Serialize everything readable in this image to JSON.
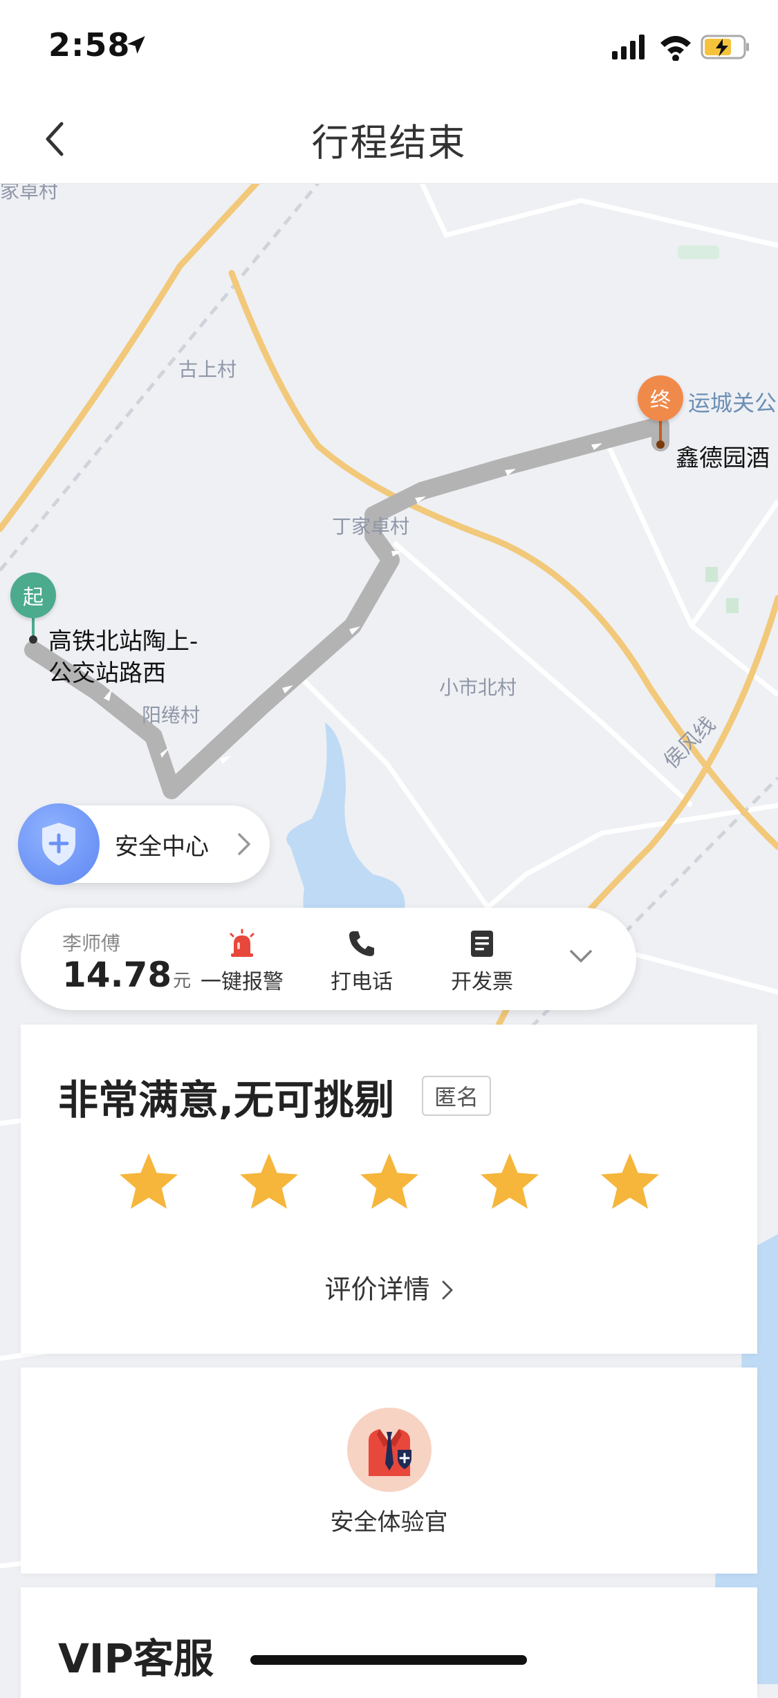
{
  "status_bar": {
    "time": "2:58"
  },
  "header": {
    "title": "行程结束"
  },
  "map": {
    "labels": [
      "家卓村",
      "古上村",
      "丁家卓村",
      "小市北村",
      "阳绻村",
      "侯风线",
      "运城关公"
    ],
    "start_pin": "起",
    "end_pin": "终",
    "start_line1": "高铁北站陶上-",
    "start_line2": "公交站路西",
    "end_label": "鑫德园酒"
  },
  "safety_center": {
    "label": "安全中心"
  },
  "driver": {
    "name": "李师傅",
    "price": "14.78",
    "currency": "元",
    "actions": [
      {
        "label": "一键报警"
      },
      {
        "label": "打电话"
      },
      {
        "label": "开发票"
      }
    ]
  },
  "rating": {
    "title": "非常满意,无可挑剔",
    "anonymous_tag": "匿名",
    "stars": 5,
    "detail_link": "评价详情"
  },
  "safety_badge": {
    "label": "安全体验官"
  },
  "vip": {
    "title": "VIP客服"
  },
  "colors": {
    "start_green": "#4bab8c",
    "end_orange": "#f08a4b",
    "route_gray": "#b3b3b3",
    "road_yellow": "#f2c97a",
    "star_gold": "#f5b63b",
    "shield_blue": "#6b92f5",
    "alarm_red": "#e8473b"
  }
}
